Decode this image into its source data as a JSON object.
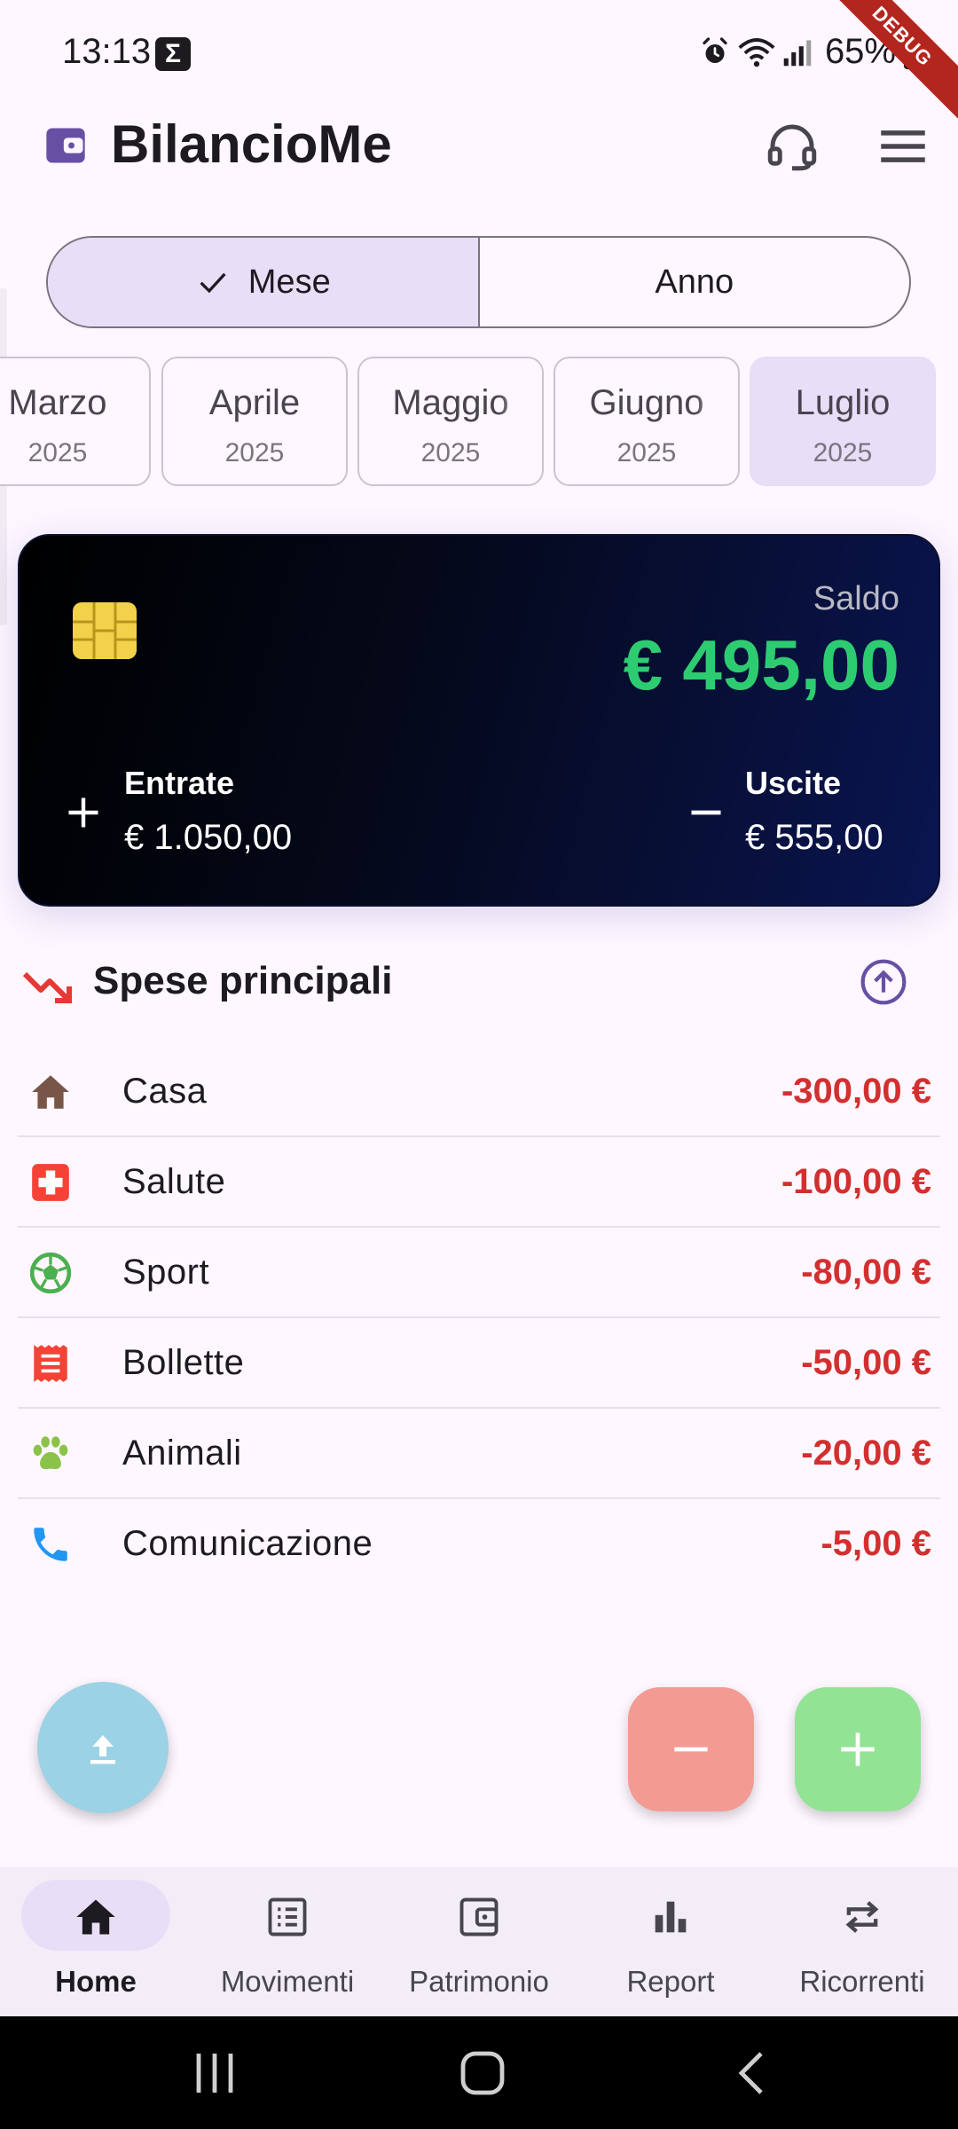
{
  "status_bar": {
    "time": "13:13",
    "notification_glyph": "Σ",
    "battery": "65%",
    "debug_banner": "DEBUG"
  },
  "app_bar": {
    "title": "BilancioMe",
    "logo_icon": "wallet-icon",
    "support_icon": "headset-icon",
    "menu_icon": "menu-icon"
  },
  "period_toggle": {
    "options": [
      "Mese",
      "Anno"
    ],
    "selected": "Mese"
  },
  "months": [
    {
      "name": "Marzo",
      "year": "2025"
    },
    {
      "name": "Aprile",
      "year": "2025"
    },
    {
      "name": "Maggio",
      "year": "2025"
    },
    {
      "name": "Giugno",
      "year": "2025"
    },
    {
      "name": "Luglio",
      "year": "2025",
      "selected": true
    }
  ],
  "balance_card": {
    "saldo_label": "Saldo",
    "saldo_value": "€ 495,00",
    "income_label": "Entrate",
    "income_value": "€ 1.050,00",
    "expense_label": "Uscite",
    "expense_value": "€ 555,00",
    "saldo_color": "#2ECC71"
  },
  "top_expenses": {
    "title": "Spese principali",
    "items": [
      {
        "name": "Casa",
        "amount": "-300,00 €",
        "icon": "home-icon",
        "color": "#795548"
      },
      {
        "name": "Salute",
        "amount": "-100,00 €",
        "icon": "medical-cross-icon",
        "color": "#F44336"
      },
      {
        "name": "Sport",
        "amount": "-80,00 €",
        "icon": "soccer-ball-icon",
        "color": "#4CAF50"
      },
      {
        "name": "Bollette",
        "amount": "-50,00 €",
        "icon": "receipt-icon",
        "color": "#F44336"
      },
      {
        "name": "Animali",
        "amount": "-20,00 €",
        "icon": "paw-icon",
        "color": "#8BC34A"
      },
      {
        "name": "Comunicazione",
        "amount": "-5,00 €",
        "icon": "phone-icon",
        "color": "#2196F3"
      }
    ],
    "amount_color": "#D32F2F"
  },
  "fabs": {
    "upload_icon": "upload-icon",
    "minus_icon": "minus-icon",
    "plus_icon": "plus-icon"
  },
  "bottom_nav": [
    {
      "label": "Home",
      "icon": "home-icon",
      "active": true
    },
    {
      "label": "Movimenti",
      "icon": "list-icon"
    },
    {
      "label": "Patrimonio",
      "icon": "wallet-icon"
    },
    {
      "label": "Report",
      "icon": "bar-chart-icon"
    },
    {
      "label": "Ricorrenti",
      "icon": "repeat-icon"
    }
  ]
}
